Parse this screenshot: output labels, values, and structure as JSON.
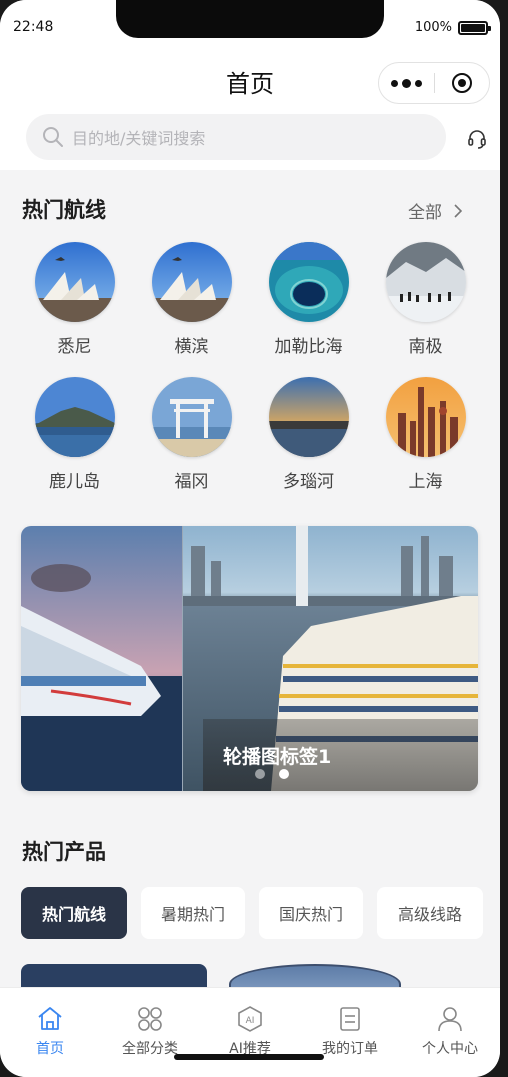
{
  "status": {
    "time": "22:48",
    "battery": "100%"
  },
  "nav": {
    "title": "首页"
  },
  "search": {
    "placeholder": "目的地/关键词搜索"
  },
  "hot_routes": {
    "title": "热门航线",
    "more": "全部",
    "items": [
      {
        "label": "悉尼"
      },
      {
        "label": "横滨"
      },
      {
        "label": "加勒比海"
      },
      {
        "label": "南极"
      },
      {
        "label": "鹿儿岛"
      },
      {
        "label": "福冈"
      },
      {
        "label": "多瑙河"
      },
      {
        "label": "上海"
      }
    ]
  },
  "banner": {
    "caption": "轮播图标签1",
    "slide_count": 2,
    "active_index": 1
  },
  "hot_products": {
    "title": "热门产品",
    "tabs": [
      "热门航线",
      "暑期热门",
      "国庆热门",
      "高级线路"
    ],
    "active_tab": 0
  },
  "tabbar": {
    "items": [
      {
        "label": "首页",
        "icon": "home-icon"
      },
      {
        "label": "全部分类",
        "icon": "category-icon"
      },
      {
        "label": "AI推荐",
        "icon": "ai-icon"
      },
      {
        "label": "我的订单",
        "icon": "order-icon"
      },
      {
        "label": "个人中心",
        "icon": "user-icon"
      }
    ],
    "active_index": 0
  },
  "colors": {
    "accent": "#3a86f0",
    "active_tab_bg": "#2a3447"
  }
}
